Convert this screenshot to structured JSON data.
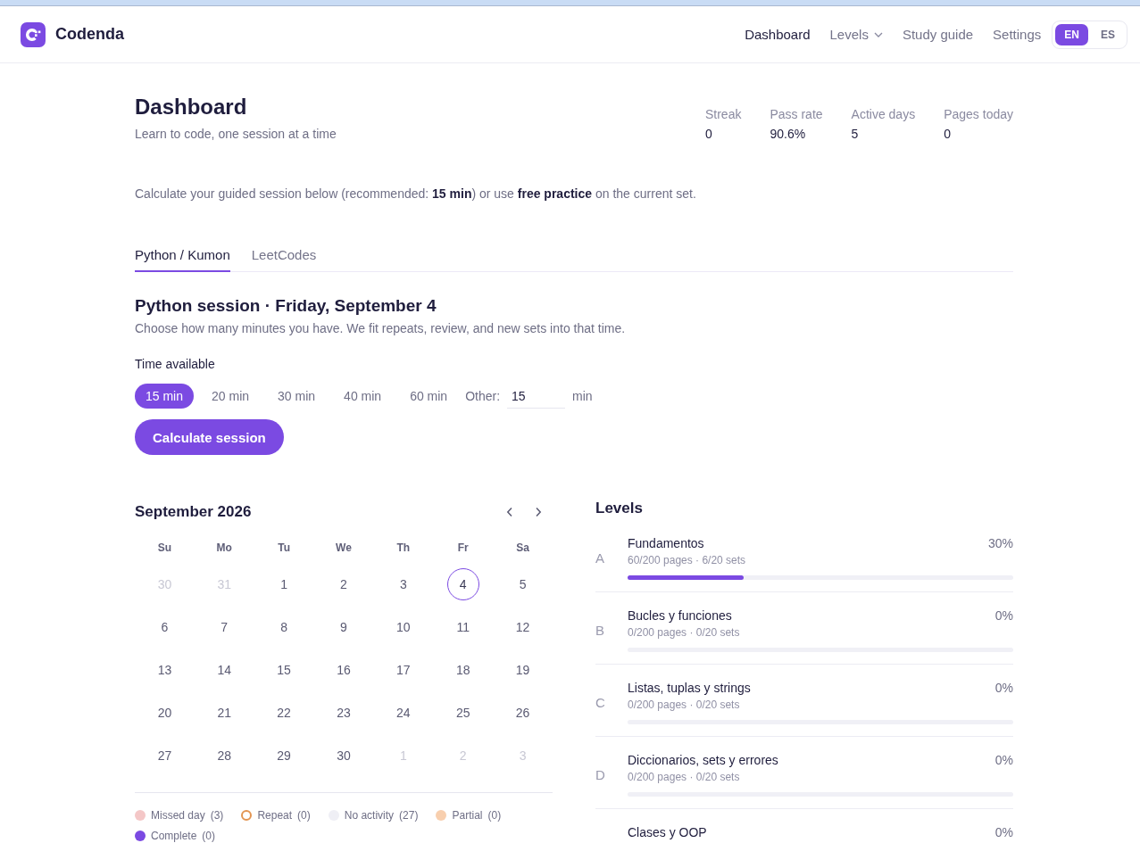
{
  "header": {
    "brand": "Codenda",
    "nav": [
      {
        "label": "Dashboard",
        "kind": "link",
        "selected": true
      },
      {
        "label": "Levels",
        "kind": "dropdown",
        "selected": false
      },
      {
        "label": "Study guide",
        "kind": "link",
        "selected": false
      },
      {
        "label": "Settings",
        "kind": "link",
        "selected": false
      }
    ],
    "language": [
      {
        "label": "EN",
        "selected": true
      },
      {
        "label": "ES",
        "selected": false
      }
    ]
  },
  "page": {
    "title": "Dashboard",
    "subtitle": "Learn to code, one session at a time",
    "stats": [
      {
        "label": "Streak",
        "value": "0"
      },
      {
        "label": "Pass rate",
        "value": "90.6%"
      },
      {
        "label": "Active days",
        "value": "5"
      },
      {
        "label": "Pages today",
        "value": "0"
      }
    ],
    "intro": "Calculate your guided session below (recommended: **15 min**) or use **free practice** on the current set."
  },
  "tabs": [
    {
      "label": "Python / Kumon",
      "selected": true
    },
    {
      "label": "LeetCodes",
      "selected": false
    }
  ],
  "session": {
    "title": "Python session · Friday, September 4",
    "description": "Choose how many minutes you have. We fit repeats, review, and new sets into that time.",
    "time_label": "Time available",
    "options": [
      {
        "label": "15 min",
        "selected": true
      },
      {
        "label": "20 min",
        "selected": false
      },
      {
        "label": "30 min",
        "selected": false
      },
      {
        "label": "40 min",
        "selected": false
      },
      {
        "label": "60 min",
        "selected": false
      }
    ],
    "other_label": "Other:",
    "other_value": "15",
    "other_unit": "min",
    "button": "Calculate session"
  },
  "calendar": {
    "title": "September 2026",
    "weekdays": [
      "Su",
      "Mo",
      "Tu",
      "We",
      "Th",
      "Fr",
      "Sa"
    ],
    "weeks": [
      [
        {
          "day": "30",
          "outside": true,
          "selected": false
        },
        {
          "day": "31",
          "outside": true,
          "selected": false
        },
        {
          "day": "1",
          "outside": false,
          "selected": false
        },
        {
          "day": "2",
          "outside": false,
          "selected": false
        },
        {
          "day": "3",
          "outside": false,
          "selected": false
        },
        {
          "day": "4",
          "outside": false,
          "selected": true
        },
        {
          "day": "5",
          "outside": false,
          "selected": false
        }
      ],
      [
        {
          "day": "6",
          "outside": false,
          "selected": false
        },
        {
          "day": "7",
          "outside": false,
          "selected": false
        },
        {
          "day": "8",
          "outside": false,
          "selected": false
        },
        {
          "day": "9",
          "outside": false,
          "selected": false
        },
        {
          "day": "10",
          "outside": false,
          "selected": false
        },
        {
          "day": "11",
          "outside": false,
          "selected": false
        },
        {
          "day": "12",
          "outside": false,
          "selected": false
        }
      ],
      [
        {
          "day": "13",
          "outside": false,
          "selected": false
        },
        {
          "day": "14",
          "outside": false,
          "selected": false
        },
        {
          "day": "15",
          "outside": false,
          "selected": false
        },
        {
          "day": "16",
          "outside": false,
          "selected": false
        },
        {
          "day": "17",
          "outside": false,
          "selected": false
        },
        {
          "day": "18",
          "outside": false,
          "selected": false
        },
        {
          "day": "19",
          "outside": false,
          "selected": false
        }
      ],
      [
        {
          "day": "20",
          "outside": false,
          "selected": false
        },
        {
          "day": "21",
          "outside": false,
          "selected": false
        },
        {
          "day": "22",
          "outside": false,
          "selected": false
        },
        {
          "day": "23",
          "outside": false,
          "selected": false
        },
        {
          "day": "24",
          "outside": false,
          "selected": false
        },
        {
          "day": "25",
          "outside": false,
          "selected": false
        },
        {
          "day": "26",
          "outside": false,
          "selected": false
        }
      ],
      [
        {
          "day": "27",
          "outside": false,
          "selected": false
        },
        {
          "day": "28",
          "outside": false,
          "selected": false
        },
        {
          "day": "29",
          "outside": false,
          "selected": false
        },
        {
          "day": "30",
          "outside": false,
          "selected": false
        },
        {
          "day": "1",
          "outside": true,
          "selected": false
        },
        {
          "day": "2",
          "outside": true,
          "selected": false
        },
        {
          "day": "3",
          "outside": true,
          "selected": false
        }
      ]
    ],
    "legend": [
      {
        "label": "Missed day",
        "count": "(3)",
        "kind": "filled",
        "color": "#f4c7c7"
      },
      {
        "label": "Repeat",
        "count": "(0)",
        "kind": "ring",
        "color": "#e39552"
      },
      {
        "label": "No activity",
        "count": "(27)",
        "kind": "filled",
        "color": "#efeff5"
      },
      {
        "label": "Partial",
        "count": "(0)",
        "kind": "filled",
        "color": "#f8cfae"
      },
      {
        "label": "Complete",
        "count": "(0)",
        "kind": "filled",
        "color": "#7b4ae2"
      }
    ]
  },
  "levels": {
    "title": "Levels",
    "items": [
      {
        "letter": "A",
        "name": "Fundamentos",
        "detail": "60/200 pages · 6/20 sets",
        "percent": "30%",
        "level": 0.3
      },
      {
        "letter": "B",
        "name": "Bucles y funciones",
        "detail": "0/200 pages · 0/20 sets",
        "percent": "0%",
        "level": 0
      },
      {
        "letter": "C",
        "name": "Listas, tuplas y strings",
        "detail": "0/200 pages · 0/20 sets",
        "percent": "0%",
        "level": 0
      },
      {
        "letter": "D",
        "name": "Diccionarios, sets y errores",
        "detail": "0/200 pages · 0/20 sets",
        "percent": "0%",
        "level": 0
      },
      {
        "name": "Clases y OOP",
        "percent": "0%"
      }
    ]
  }
}
